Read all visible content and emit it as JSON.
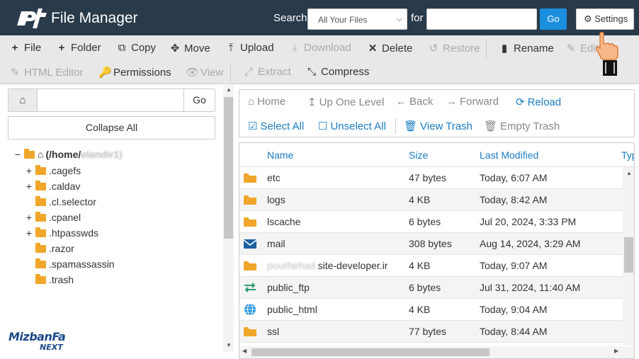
{
  "header": {
    "title": "File Manager",
    "search_label": "Search",
    "search_scope": "All Your Files",
    "for_label": "for",
    "search_value": "",
    "go_label": "Go",
    "settings_label": "Settings"
  },
  "toolbar": {
    "file": "File",
    "folder": "Folder",
    "copy": "Copy",
    "move": "Move",
    "upload": "Upload",
    "download": "Download",
    "delete": "Delete",
    "restore": "Restore",
    "rename": "Rename",
    "edit": "Edit",
    "html_editor": "HTML Editor",
    "permissions": "Permissions",
    "view": "View",
    "extract": "Extract",
    "compress": "Compress"
  },
  "left": {
    "path_value": "",
    "go_label": "Go",
    "collapse_label": "Collapse All",
    "root_label": "(/home/",
    "root_user_blurred": "elandir1)",
    "tree": [
      {
        "label": ".cagefs",
        "toggle": "+"
      },
      {
        "label": ".caldav",
        "toggle": "+"
      },
      {
        "label": ".cl.selector",
        "toggle": ""
      },
      {
        "label": ".cpanel",
        "toggle": "+"
      },
      {
        "label": ".htpasswds",
        "toggle": "+"
      },
      {
        "label": ".razor",
        "toggle": ""
      },
      {
        "label": ".spamassassin",
        "toggle": ""
      },
      {
        "label": ".trash",
        "toggle": ""
      }
    ],
    "root_toggle": "−"
  },
  "brand": {
    "top": "MizbanFa",
    "bottom": "NEXT"
  },
  "nav": {
    "home": "Home",
    "up": "Up One Level",
    "back": "Back",
    "forward": "Forward",
    "reload": "Reload",
    "select_all": "Select All",
    "unselect_all": "Unselect All",
    "view_trash": "View Trash",
    "empty_trash": "Empty Trash"
  },
  "table": {
    "columns": {
      "name": "Name",
      "size": "Size",
      "modified": "Last Modified",
      "type": "Type"
    },
    "rows": [
      {
        "icon": "folder",
        "name": "etc",
        "size": "47 bytes",
        "modified": "Today, 6:07 AM"
      },
      {
        "icon": "folder",
        "name": "logs",
        "size": "4 KB",
        "modified": "Today, 8:42 AM"
      },
      {
        "icon": "folder",
        "name": "lscache",
        "size": "6 bytes",
        "modified": "Jul 20, 2024, 3:33 PM"
      },
      {
        "icon": "mail",
        "name": "mail",
        "size": "308 bytes",
        "modified": "Aug 14, 2024, 3:29 AM"
      },
      {
        "icon": "folder",
        "name_blurred": "pourfarhad.",
        "name": "site-developer.ir",
        "size": "4 KB",
        "modified": "Today, 9:07 AM"
      },
      {
        "icon": "ftp",
        "name": "public_ftp",
        "size": "6 bytes",
        "modified": "Jul 31, 2024, 11:40 AM"
      },
      {
        "icon": "globe",
        "name": "public_html",
        "size": "4 KB",
        "modified": "Today, 9:04 AM"
      },
      {
        "icon": "folder",
        "name": "ssl",
        "size": "77 bytes",
        "modified": "Today, 8:44 AM"
      }
    ]
  },
  "colors": {
    "header_bg": "#293a4a",
    "accent": "#1b8fdd",
    "link": "#1b7cc0",
    "folder": "#f0a62b"
  }
}
